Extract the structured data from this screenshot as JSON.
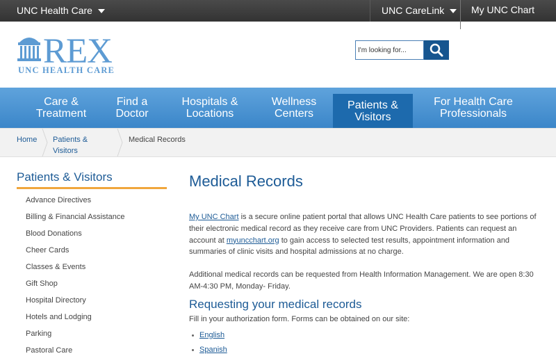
{
  "topbar": {
    "left_label": "UNC Health Care",
    "carelink_label": "UNC CareLink",
    "mychart_label": "My UNC Chart"
  },
  "logo": {
    "wordmark": "REX",
    "subtitle": "UNC HEALTH CARE"
  },
  "search": {
    "placeholder": "I'm looking for...",
    "button_icon": "search-icon"
  },
  "nav": {
    "items": [
      {
        "label": "Care & Treatment"
      },
      {
        "label": "Find a Doctor"
      },
      {
        "label": "Hospitals & Locations"
      },
      {
        "label": "Wellness Centers"
      },
      {
        "label": "Patients & Visitors",
        "active": true
      },
      {
        "label": "For Health Care Professionals"
      }
    ]
  },
  "breadcrumb": {
    "home": "Home",
    "section": "Patients & Visitors",
    "current": "Medical Records"
  },
  "sidebar": {
    "title": "Patients & Visitors",
    "items": [
      "Advance Directives",
      "Billing & Financial Assistance",
      "Blood Donations",
      "Cheer Cards",
      "Classes & Events",
      "Gift Shop",
      "Hospital Directory",
      "Hotels and Lodging",
      "Parking",
      "Pastoral Care"
    ]
  },
  "main": {
    "title": "Medical Records",
    "intro_link": "My UNC Chart",
    "intro_text_1": " is a secure online patient portal that allows UNC Health Care patients to see portions of their electronic medical record as they receive care from UNC Providers. Patients can request an account at ",
    "intro_link_2": "myuncchart.org",
    "intro_text_2": " to gain access to selected test results, appointment information and summaries of clinic visits and hospital admissions at no charge.",
    "additional": "Additional medical records can be requested from Health Information Management. We are open 8:30 AM-4:30 PM, Monday- Friday.",
    "section_heading": "Requesting your medical records",
    "section_text": "Fill in your authorization form. Forms can be obtained on our site:",
    "form_links": [
      "English",
      "Spanish"
    ]
  },
  "colors": {
    "brand_blue": "#1d5b96",
    "nav_blue": "#3b86c9",
    "nav_active": "#1d6aad",
    "accent_orange": "#f0a63c",
    "topbar_dark": "#3a3a3a"
  }
}
